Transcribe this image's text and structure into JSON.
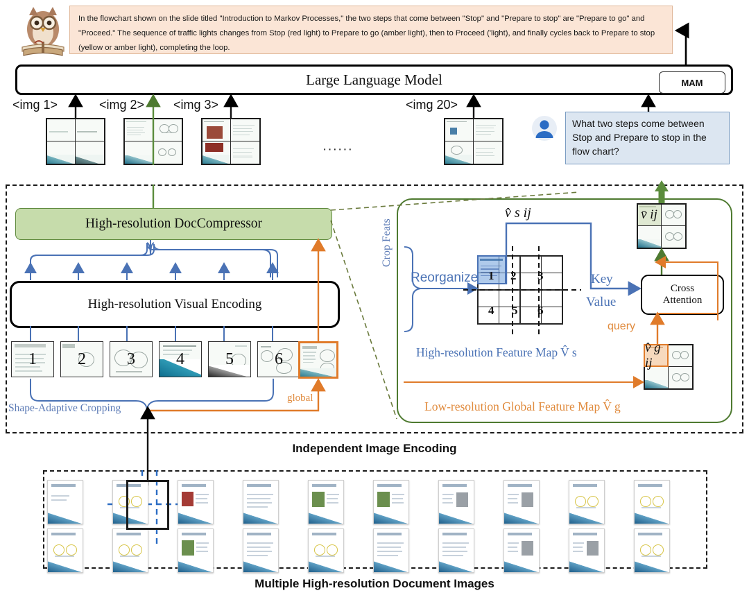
{
  "answer": {
    "text": "In the flowchart shown on the slide titled \"Introduction to Markov Processes,\" the two steps that come between \"Stop\" and \"Prepare to stop\" are \"Prepare to go\" and \"Proceed.\" The sequence of traffic lights changes from Stop (red light) to Prepare to go (amber light), then to Proceed ('light), and finally cycles back to Prepare to stop (yellow or amber light), completing the loop."
  },
  "model": {
    "title": "Large Language Model",
    "mam_label": "MAM"
  },
  "inputs": {
    "image_labels": [
      "<img 1>",
      "<img 2>",
      "<img 3>",
      "<img 20>"
    ],
    "ellipsis": "······"
  },
  "question": {
    "text": "What two steps come between Stop and Prepare to stop in the flow chart?"
  },
  "encoding": {
    "section_label": "Independent Image Encoding",
    "doccompressor_label": "High-resolution DocCompressor",
    "visual_encoding_label": "High-resolution Visual Encoding",
    "crop_numbers": [
      "1",
      "2",
      "3",
      "4",
      "5",
      "6"
    ],
    "shape_adaptive_label": "Shape-Adaptive Cropping",
    "global_label": "global"
  },
  "detail": {
    "crop_feats_label": "Crop Feats",
    "reorganize_label": "Reorganize",
    "key_label": "Key",
    "value_label": "Value",
    "query_label": "query",
    "cross_attention_line1": "Cross",
    "cross_attention_line2": "Attention",
    "hr_feature_map_label": "High-resolution Feature Map V̂ s",
    "lr_feature_map_label": "Low-resolution Global Feature Map V̂ g",
    "vs_symbol": "v̂ s ij",
    "vbar_symbol": "v̄ ij",
    "vg_symbol": "v̂ g ij",
    "grid_numbers": [
      "1",
      "2",
      "3",
      "4",
      "5",
      "6"
    ]
  },
  "documents": {
    "section_label": "Multiple High-resolution Document Images",
    "count_row1": 10,
    "count_row2": 10
  },
  "colors": {
    "answer_bg": "#fbe5d6",
    "answer_border": "#e0b89a",
    "question_bg": "#dce6f1",
    "question_border": "#7a9cc2",
    "doccompressor_bg": "#c6dcab",
    "doccompressor_border": "#5f8a3e",
    "panel_border": "#4e7a30",
    "blue_accent": "#4a72b5",
    "orange_accent": "#e08a3c",
    "green_arrow": "#5b8c3c"
  }
}
